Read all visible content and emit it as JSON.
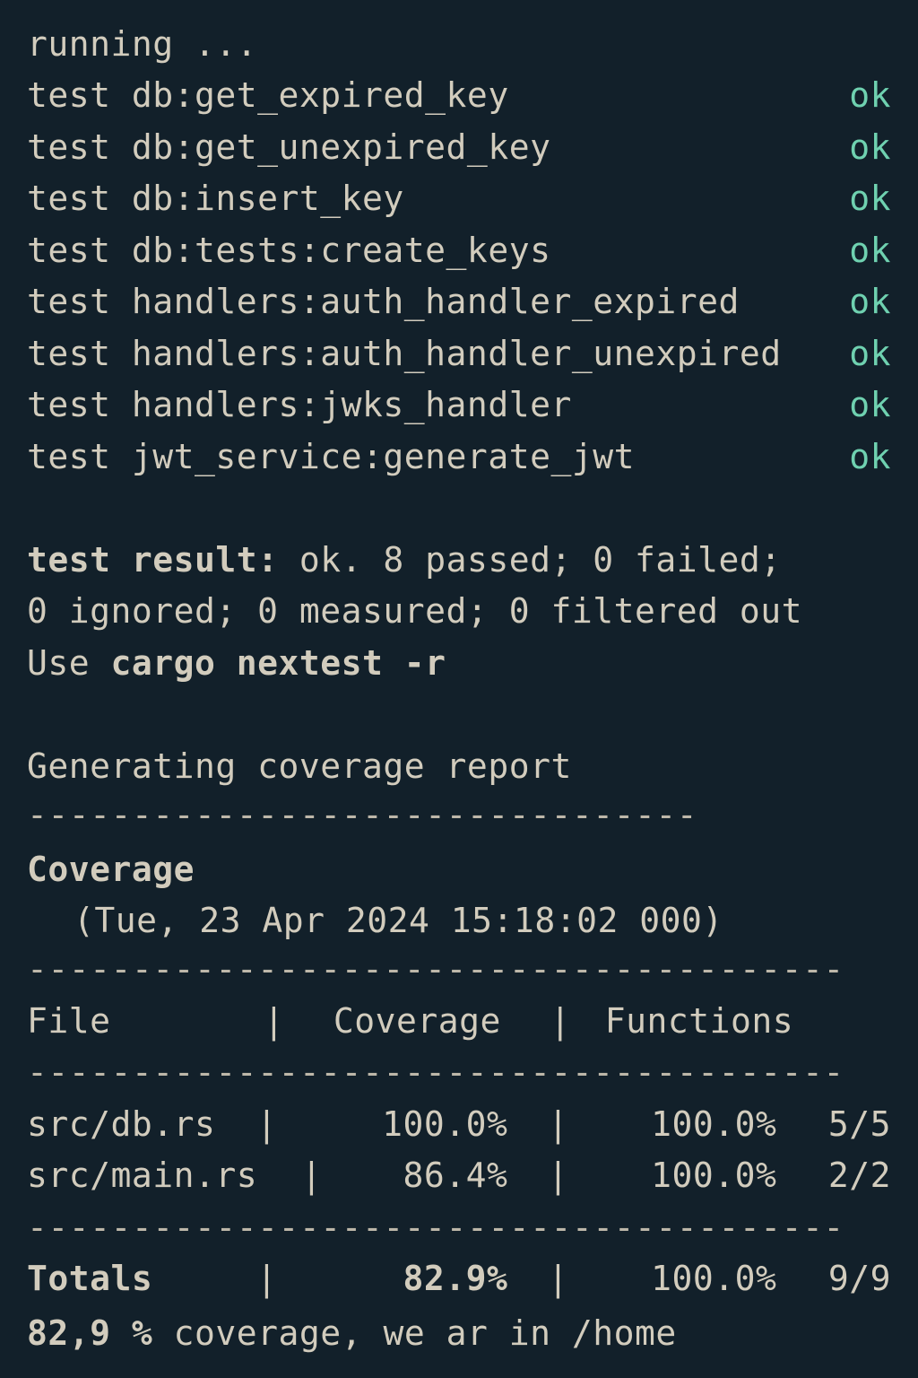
{
  "terminal": {
    "running": "running ...",
    "tests": [
      {
        "name": "test db:get_expired_key",
        "status": "ok"
      },
      {
        "name": "test db:get_unexpired_key",
        "status": "ok"
      },
      {
        "name": "test db:insert_key",
        "status": "ok"
      },
      {
        "name": "test db:tests:create_keys",
        "status": "ok"
      },
      {
        "name": "test handlers:auth_handler_expired",
        "status": "ok"
      },
      {
        "name": "test handlers:auth_handler_unexpired",
        "status": "ok"
      },
      {
        "name": "test handlers:jwks_handler",
        "status": "ok"
      },
      {
        "name": "test jwt_service:generate_jwt",
        "status": "ok"
      }
    ],
    "result_line1_bold": "test result:",
    "result_line1_rest": " ok. 8 passed; 0 failed;",
    "result_line2": "0 ignored; 0 measured; 0 filtered out",
    "use_prefix": "Use ",
    "use_command": "cargo nextest -r",
    "generating": "Generating coverage report",
    "divider_short": "--------------------------------",
    "coverage_title": "Coverage",
    "coverage_date": "(Tue, 23 Apr 2024 15:18:02 000)",
    "divider_long": "---------------------------------------",
    "table": {
      "headers": {
        "file": "File",
        "coverage": "Coverage",
        "functions": "Functions"
      },
      "rows": [
        {
          "file": "src/db.rs",
          "coverage": "100.0%",
          "functions": "100.0%",
          "count": "5/5"
        },
        {
          "file": "src/main.rs",
          "coverage": "86.4%",
          "functions": "100.0%",
          "count": "2/2"
        }
      ],
      "totals": {
        "label": "Totals",
        "coverage": "82.9%",
        "functions": "100.0%",
        "count": "9/9"
      }
    },
    "summary_bold": "82,9 %",
    "summary_rest": " coverage, we ar in /home",
    "colors": {
      "background": "#12202a",
      "text": "#d2ccbd",
      "ok": "#6fd1b0"
    }
  }
}
